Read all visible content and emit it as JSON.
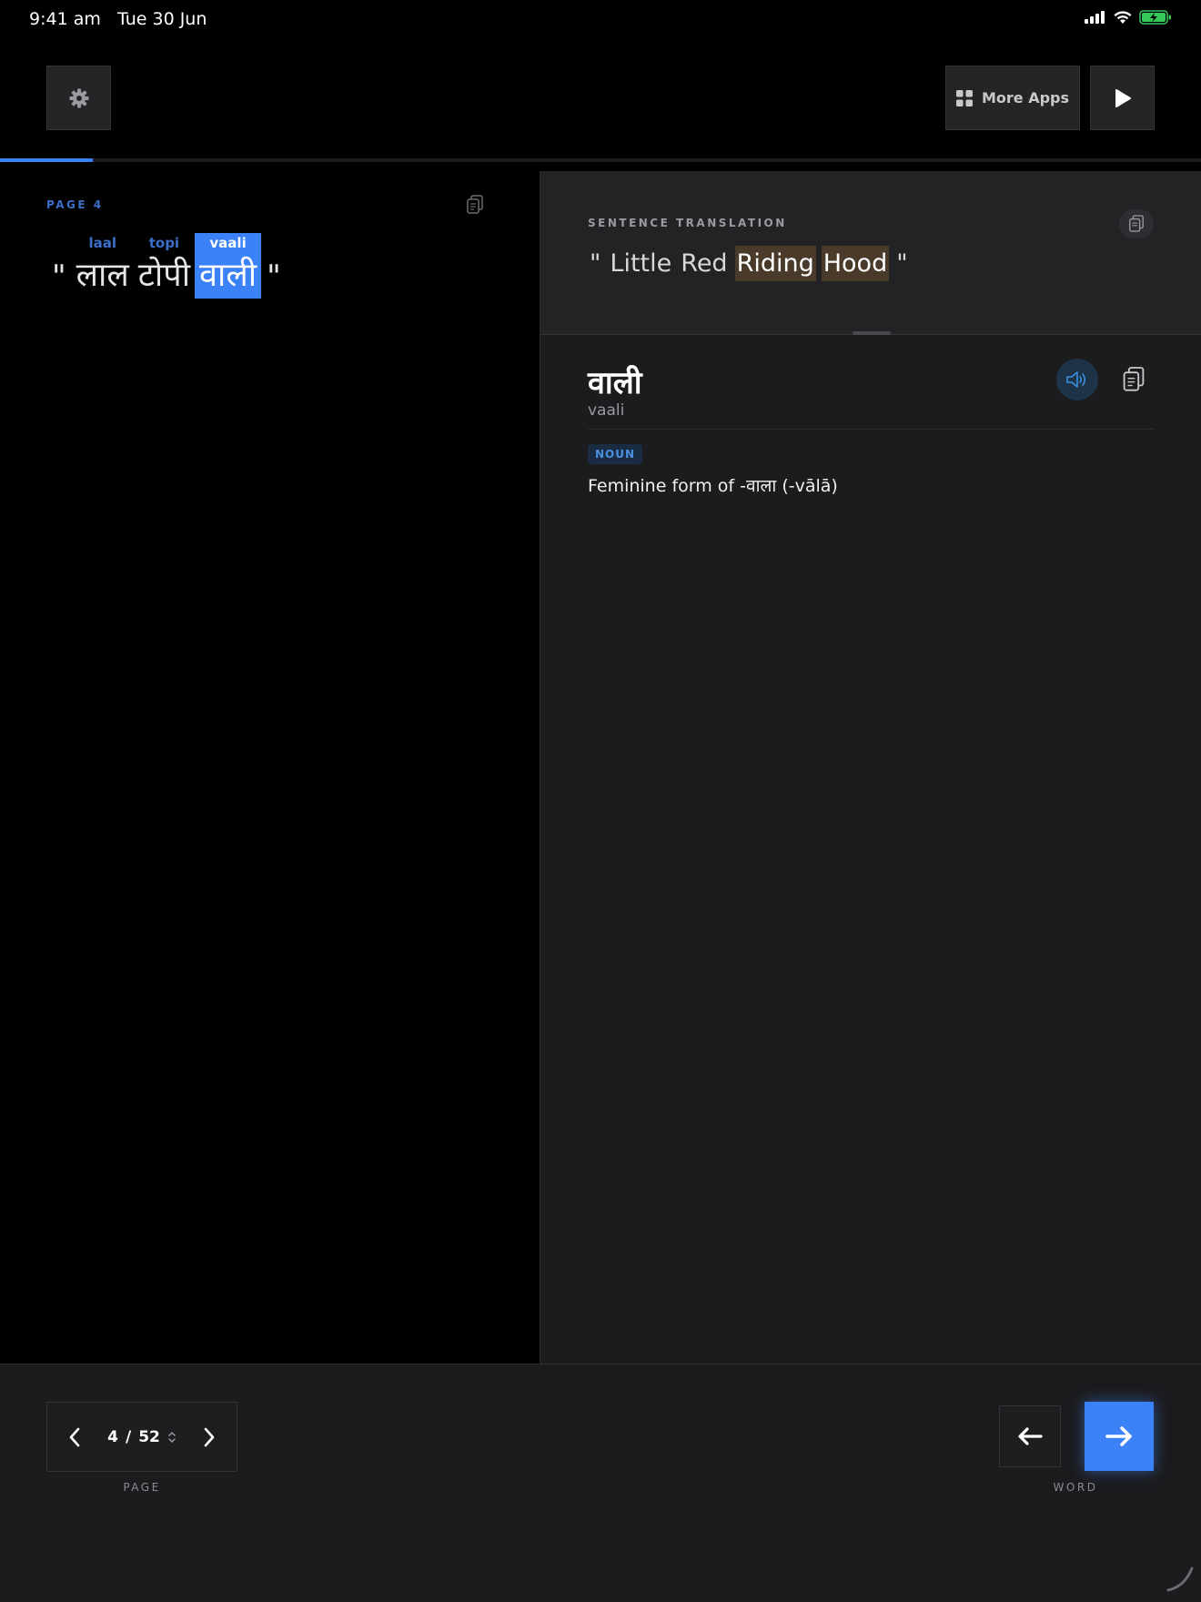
{
  "status_bar": {
    "time": "9:41 am",
    "date": "Tue 30 Jun",
    "battery_color": "#34c759"
  },
  "toolbar": {
    "more_apps_label": "More Apps",
    "settings_icon": "gear-icon",
    "play_icon": "play-icon"
  },
  "reading_progress": 0.077,
  "left_panel": {
    "page_label": "PAGE 4",
    "sentence": {
      "open_quote": "\"",
      "close_quote": "\"",
      "words": [
        {
          "translit": "laal",
          "hindi": "लाल",
          "active": false
        },
        {
          "translit": "topi",
          "hindi": "टोपी",
          "active": false
        },
        {
          "translit": "vaali",
          "hindi": "वाली",
          "active": true
        }
      ]
    }
  },
  "translation": {
    "label": "SENTENCE TRANSLATION",
    "open_quote": "\"",
    "close_quote": "\"",
    "words": [
      {
        "text": "Little",
        "highlighted": false
      },
      {
        "text": "Red",
        "highlighted": false
      },
      {
        "text": "Riding",
        "highlighted": true
      },
      {
        "text": "Hood",
        "highlighted": true
      }
    ],
    "highlight_color": "#4a3a2a"
  },
  "definition": {
    "word": "वाली",
    "translit": "vaali",
    "part_of_speech": "NOUN",
    "meaning": "Feminine form of -वाला (-vālā)"
  },
  "bottom_bar": {
    "current_page": "4",
    "separator": "/",
    "total_pages": "52",
    "page_caption": "PAGE",
    "word_caption": "WORD"
  },
  "colors": {
    "accent": "#3b82f6",
    "panel": "#1c1c1f",
    "background": "#000000"
  }
}
